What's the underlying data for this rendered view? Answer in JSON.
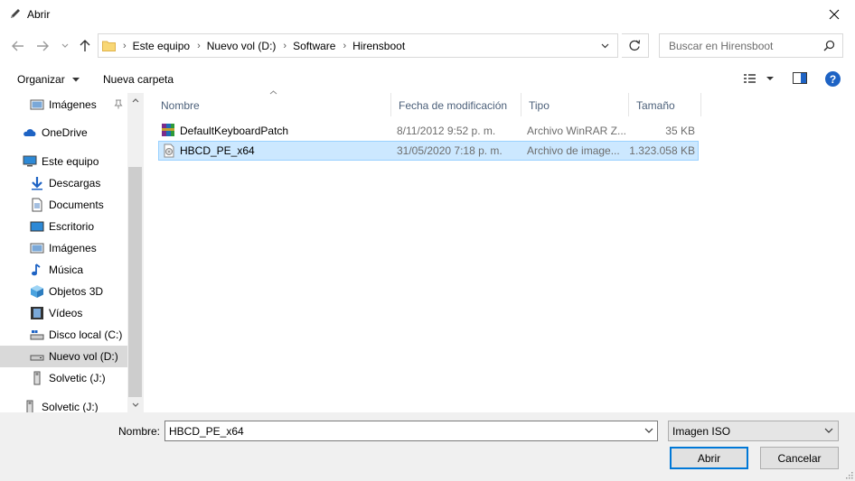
{
  "window": {
    "title": "Abrir",
    "accent": "#0078d7"
  },
  "navigation": {
    "path": [
      "Este equipo",
      "Nuevo vol (D:)",
      "Software",
      "Hirensboot"
    ],
    "search_placeholder": "Buscar en Hirensboot"
  },
  "toolbar": {
    "organize": "Organizar",
    "new_folder": "Nueva carpeta"
  },
  "nav_pane": {
    "items": [
      {
        "label": "Imágenes",
        "icon": "pictures-icon"
      },
      {
        "label": "OneDrive",
        "icon": "cloud-icon"
      },
      {
        "label": "Este equipo",
        "icon": "computer-icon"
      },
      {
        "label": "Descargas",
        "icon": "download-icon"
      },
      {
        "label": "Documents",
        "icon": "document-icon"
      },
      {
        "label": "Escritorio",
        "icon": "desktop-icon"
      },
      {
        "label": "Imágenes",
        "icon": "pictures-icon"
      },
      {
        "label": "Música",
        "icon": "music-icon"
      },
      {
        "label": "Objetos 3D",
        "icon": "cube-icon"
      },
      {
        "label": "Vídeos",
        "icon": "video-icon"
      },
      {
        "label": "Disco local (C:)",
        "icon": "drive-icon"
      },
      {
        "label": "Nuevo vol (D:)",
        "icon": "drive-icon"
      },
      {
        "label": "Solvetic (J:)",
        "icon": "usb-icon"
      },
      {
        "label": "Solvetic (J:)",
        "icon": "usb-icon"
      }
    ],
    "selected": "Nuevo vol (D:)"
  },
  "file_list": {
    "columns": [
      "Nombre",
      "Fecha de modificación",
      "Tipo",
      "Tamaño"
    ],
    "rows": [
      {
        "name": "DefaultKeyboardPatch",
        "date": "8/11/2012 9:52 p. m.",
        "type": "Archivo WinRAR Z...",
        "size": "35 KB",
        "icon": "winrar-icon"
      },
      {
        "name": "HBCD_PE_x64",
        "date": "31/05/2020 7:18 p. m.",
        "type": "Archivo de image...",
        "size": "1.323.058 KB",
        "icon": "disc-image-icon",
        "selected": true
      }
    ]
  },
  "footer": {
    "name_label": "Nombre:",
    "name_value": "HBCD_PE_x64",
    "file_type": "Imagen ISO",
    "open": "Abrir",
    "cancel": "Cancelar"
  }
}
